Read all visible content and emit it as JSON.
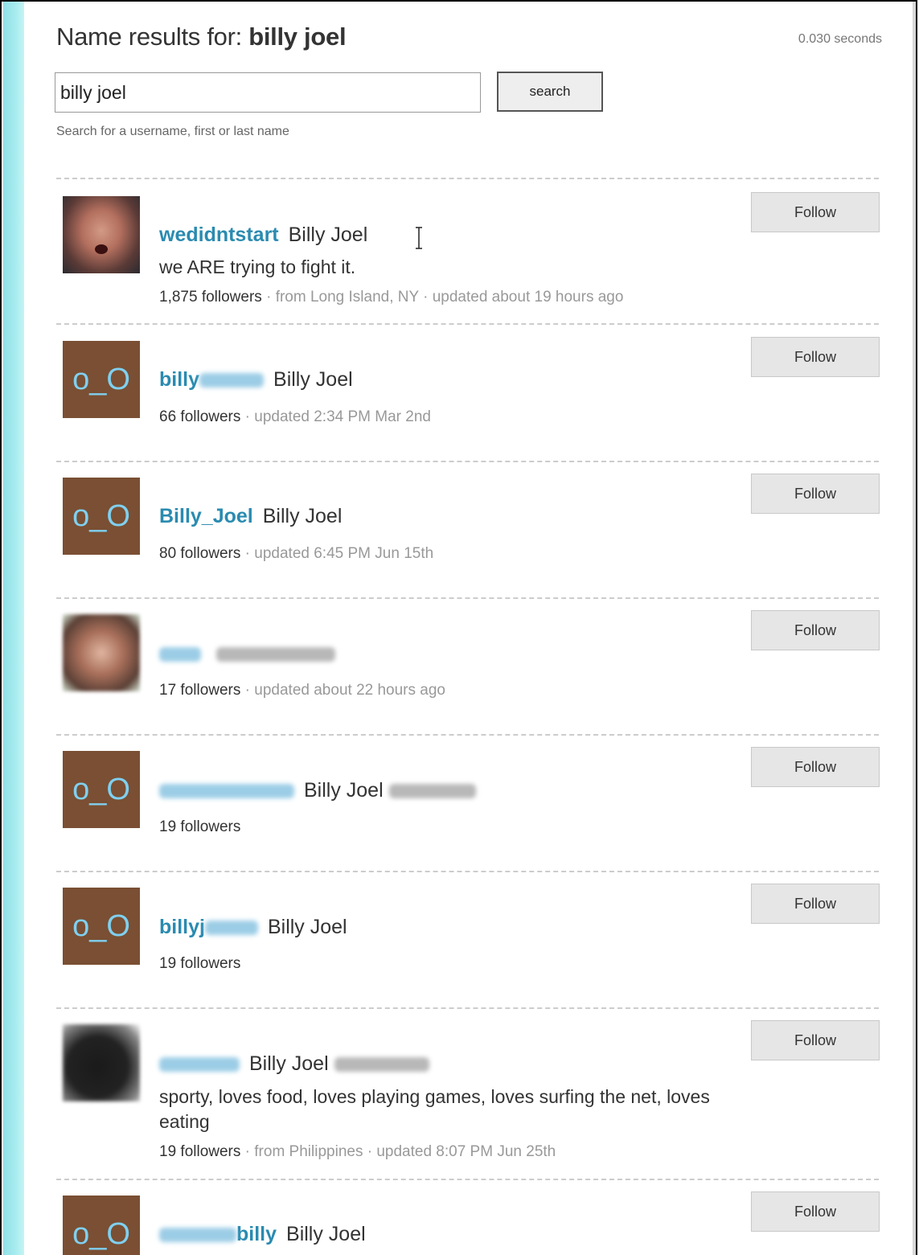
{
  "header": {
    "title_prefix": "Name results for: ",
    "query_bold": "billy joel",
    "timing": "0.030 seconds"
  },
  "search": {
    "value": "billy joel",
    "button_label": "search",
    "hint": "Search for a username, first or last name"
  },
  "follow_label": "Follow",
  "results": [
    {
      "avatar": "photo",
      "username": "wedidntstart",
      "realname": "Billy Joel",
      "bio": "we ARE trying to fight it.",
      "followers": "1,875 followers",
      "location": "from Long Island, NY",
      "updated": "updated about 19 hours ago"
    },
    {
      "avatar": "default-o_O",
      "username": "billy",
      "realname": "Billy Joel",
      "followers": "66 followers",
      "updated": "updated 2:34 PM Mar 2nd"
    },
    {
      "avatar": "default-o_O",
      "username": "Billy_Joel",
      "realname": "Billy Joel",
      "followers": "80 followers",
      "updated": "updated 6:45 PM Jun 15th"
    },
    {
      "avatar": "photo-blurred",
      "followers": "17 followers",
      "updated": "updated about 22 hours ago"
    },
    {
      "avatar": "default-o_O",
      "realname": "Billy Joel",
      "followers": "19 followers"
    },
    {
      "avatar": "default-o_O",
      "username": "billyj",
      "realname": "Billy Joel",
      "followers": "19 followers"
    },
    {
      "avatar": "photo-blurred",
      "realname": "Billy Joel",
      "bio": "sporty, loves food, loves playing games, loves surfing the net, loves eating",
      "followers": "19 followers",
      "location": "from Philippines",
      "updated": "updated 8:07 PM Jun 25th"
    },
    {
      "avatar": "default-o_O",
      "username": "billy",
      "realname": "Billy Joel"
    }
  ],
  "default_avatar_text": "o_O",
  "colors": {
    "username": "#2a8bb0",
    "default_avatar_bg": "#7a4f33",
    "default_avatar_text": "#7fd0f0",
    "left_stripe": "#a8ecef"
  }
}
